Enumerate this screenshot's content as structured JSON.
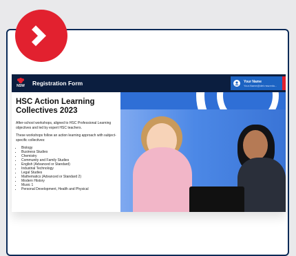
{
  "header": {
    "title": "Registration Form",
    "logo_text": "NSW",
    "user": {
      "name": "Your Name",
      "email": "Your.Name@det.nsw.edu..."
    }
  },
  "content": {
    "heading": "HSC Action Learning Collectives 2023",
    "paragraphs": [
      "After-school workshops, aligned to HSC Professional Learning objectives and led by expert HSC teachers.",
      "These workshops follow an action learning approach with subject-specific collectives:"
    ],
    "subjects": [
      "Biology",
      "Business Studies",
      "Chemistry",
      "Community and Family Studies",
      "English (Advanced or Standard)",
      "Industrial Technology",
      "Legal Studies",
      "Mathematics (Advanced or Standard 2)",
      "Modern History",
      "Music 1",
      "Personal Development, Health and Physical"
    ]
  },
  "colors": {
    "badge": "#e2212f",
    "topbar": "#0b1e3f",
    "user_box": "#1c63c2",
    "hero_bg": "#2f6fd6",
    "frame_border": "#0b2a57"
  },
  "icons": {
    "badge": "chevron-right-icon",
    "user": "user-icon",
    "logo": "nsw-waratah-logo"
  }
}
